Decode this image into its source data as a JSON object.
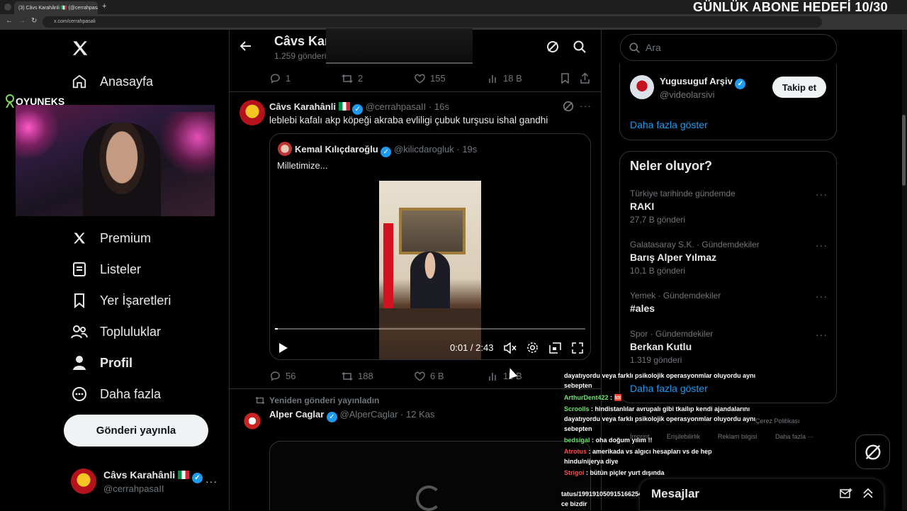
{
  "browser": {
    "tab_title": "(3) Câvs Karahânli 🇮🇹 (@cerrahpasaII) / X",
    "url": "x.com/cerrahpasali",
    "overlay_goal": "GÜNLÜK ABONE HEDEFİ 10/30"
  },
  "stream": {
    "brand": "OYUNEKS"
  },
  "nav": {
    "items": [
      {
        "label": "Anasayfa",
        "icon": "home-icon"
      },
      {
        "label": "Premium",
        "icon": "x-logo-icon"
      },
      {
        "label": "Listeler",
        "icon": "list-icon"
      },
      {
        "label": "Yer İşaretleri",
        "icon": "bookmark-icon"
      },
      {
        "label": "Topluluklar",
        "icon": "communities-icon"
      },
      {
        "label": "Profil",
        "icon": "person-icon"
      },
      {
        "label": "Daha fazla",
        "icon": "more-circle-icon"
      }
    ],
    "post_button": "Gönderi yayınla",
    "account": {
      "name": "Câvs Karahânli",
      "handle": "@cerrahpasaII"
    }
  },
  "header": {
    "title": "Câvs Karahânli",
    "subtitle": "1.259 gönderi"
  },
  "prev_post_actions": {
    "replies": "1",
    "reposts": "2",
    "likes": "155",
    "views": "18 B"
  },
  "post": {
    "author": "Câvs Karahânli",
    "handle": "@cerrahpasaII",
    "time": "16s",
    "text": "leblebi kafalı akp köpeği akraba evliligi çubuk turşusu ishal gandhi",
    "quote": {
      "author": "Kemal Kılıçdaroğlu",
      "handle": "@kilicdarogluk",
      "time": "19s",
      "text": "Milletimize..."
    },
    "video_time": "0:01 / 2:43",
    "video_progress": 0.01,
    "actions": {
      "replies": "56",
      "reposts": "188",
      "likes": "6 B",
      "views": "12 B"
    }
  },
  "repost_post": {
    "repost_label": "Yeniden gönderi yayınladın",
    "author": "Alper Caglar",
    "handle": "@AlperCaglar",
    "time": "12 Kas"
  },
  "search": {
    "placeholder": "Ara"
  },
  "who_to_follow": {
    "name": "Yugusuguf Arşiv",
    "handle": "@videolarsivi",
    "follow_label": "Takip et",
    "show_more": "Daha fazla göster"
  },
  "trends": {
    "title": "Neler oluyor?",
    "items": [
      {
        "meta": "Türkiye tarihinde gündemde",
        "title": "RAKI",
        "count": "27,7 B gönderi"
      },
      {
        "meta": "Galatasaray S.K. · Gündemdekiler",
        "title": "Barış Alper Yılmaz",
        "count": "10,1 B gönderi"
      },
      {
        "meta": "Yemek · Gündemdekiler",
        "title": "#ales",
        "count": ""
      },
      {
        "meta": "Spor · Gündemdekiler",
        "title": "Berkan Kutlu",
        "count": "1.319 gönderi"
      }
    ],
    "show_more": "Daha fazla göster"
  },
  "footer": {
    "links": [
      "Çerez Politikası",
      "İmprint",
      "Erişilebilirlik",
      "Reklam bilgisi",
      "Daha fazla ···"
    ]
  },
  "chat": [
    {
      "user": "",
      "text": "dayatıyordu veya farklı psikolojik operasyonmlar oluyordu aynı"
    },
    {
      "user": "",
      "text": "sebepten"
    },
    {
      "user": "ArthurDent422",
      "text": ": 🆘"
    },
    {
      "user": "Scroolls",
      "text": ": hindistanlılar avrupalı gibi tkailıp kendi ajandalarını"
    },
    {
      "user": "",
      "text": "dayatıyordu veya farklı psikolojik operasyonmlar oluyordu aynı"
    },
    {
      "user": "",
      "text": "sebepten"
    },
    {
      "user": "bedsigal",
      "text": ": oha doğum yılım !!"
    },
    {
      "user": "Atrotus",
      "text": ": amerikada vs algıcı hesapları vs de hep"
    },
    {
      "user": "",
      "text": "hindu/nijerya diye"
    },
    {
      "user": "Strigoi",
      "text": ": bütün piçler yurt dışında"
    },
    {
      "user": "",
      "text": "tatus/1991910509151662541"
    },
    {
      "user": "",
      "text": "ce bizdir"
    }
  ],
  "messages": {
    "label": "Mesajlar"
  },
  "colors": {
    "accent": "#1d9bf0",
    "background": "#000000",
    "border": "#2f3336"
  }
}
